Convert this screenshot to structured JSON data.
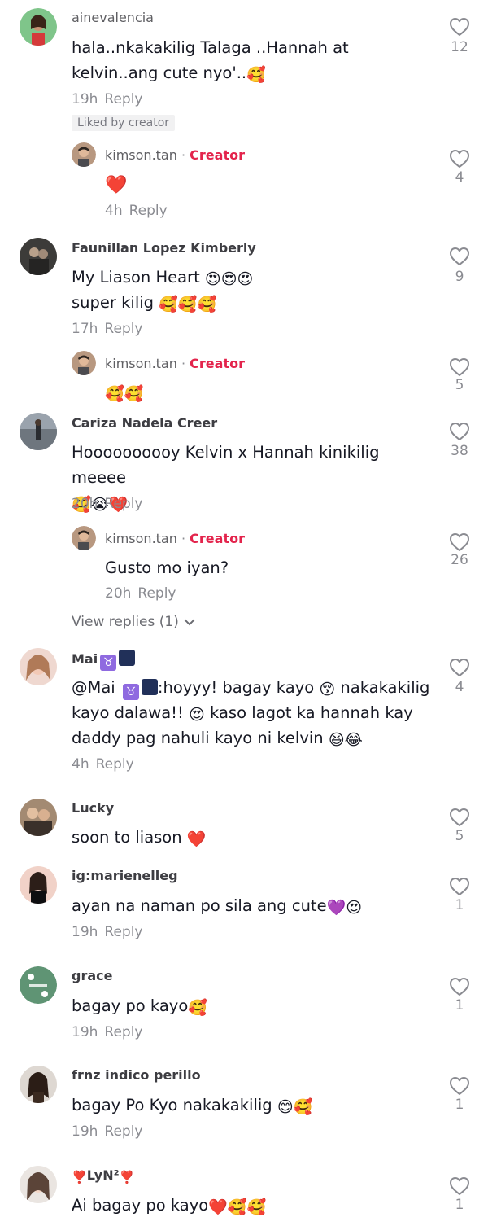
{
  "comments": [
    {
      "username": "ainevalencia",
      "text": "hala..nkakakilig Talaga ..Hannah at kelvin..ang cute nyo'..",
      "time": "19h",
      "reply": "Reply",
      "liked_label": "Liked by creator",
      "likes": "12",
      "replies": [
        {
          "username": "kimson.tan",
          "creator": "Creator",
          "text": "",
          "time": "4h",
          "reply": "Reply",
          "likes": "4"
        }
      ]
    },
    {
      "username": "Faunillan Lopez Kimberly",
      "text_line1": "My Liason Heart",
      "text_line2": "super kilig",
      "time": "17h",
      "reply": "Reply",
      "likes": "9",
      "replies": [
        {
          "username": "kimson.tan",
          "creator": "Creator",
          "text": "",
          "likes": "5"
        }
      ]
    },
    {
      "username": "Cariza Nadela Creer",
      "text": "Hoooooooooy Kelvin x Hannah kinikilig meeee",
      "time": "20h",
      "reply": "Reply",
      "likes": "38",
      "replies": [
        {
          "username": "kimson.tan",
          "creator": "Creator",
          "text": "Gusto mo iyan?",
          "time": "20h",
          "reply": "Reply",
          "likes": "26"
        }
      ],
      "view_replies": "View replies (1)"
    },
    {
      "username": "Mai",
      "text_a": "@Mai",
      "text_b": ":hoyyy! bagay kayo",
      "text_c": "nakakakilig",
      "text_d": "kayo dalawa!!",
      "text_e": "kaso lagot ka hannah kay",
      "text_f": "daddy pag nahuli kayo ni kelvin",
      "time": "4h",
      "reply": "Reply",
      "likes": "4"
    },
    {
      "username": "Lucky",
      "text": "soon to liason",
      "likes": "5"
    },
    {
      "username": "ig:marienelleg",
      "text": "ayan na naman po sila ang cute",
      "time": "19h",
      "reply": "Reply",
      "likes": "1"
    },
    {
      "username": "grace",
      "text": "bagay po kayo",
      "time": "19h",
      "reply": "Reply",
      "likes": "1"
    },
    {
      "username": "frnz indico perillo",
      "text": "bagay Po Kyo nakakakilig",
      "time": "19h",
      "reply": "Reply",
      "likes": "1"
    },
    {
      "username": "LyN²",
      "text": "Ai bagay po kayo",
      "likes": "1"
    }
  ],
  "colors": {
    "creator": "#e3244c",
    "text": "#161823",
    "muted": "#8a8b91"
  },
  "icons": {
    "like": "heart-outline-icon",
    "chevron": "chevron-down-icon"
  }
}
